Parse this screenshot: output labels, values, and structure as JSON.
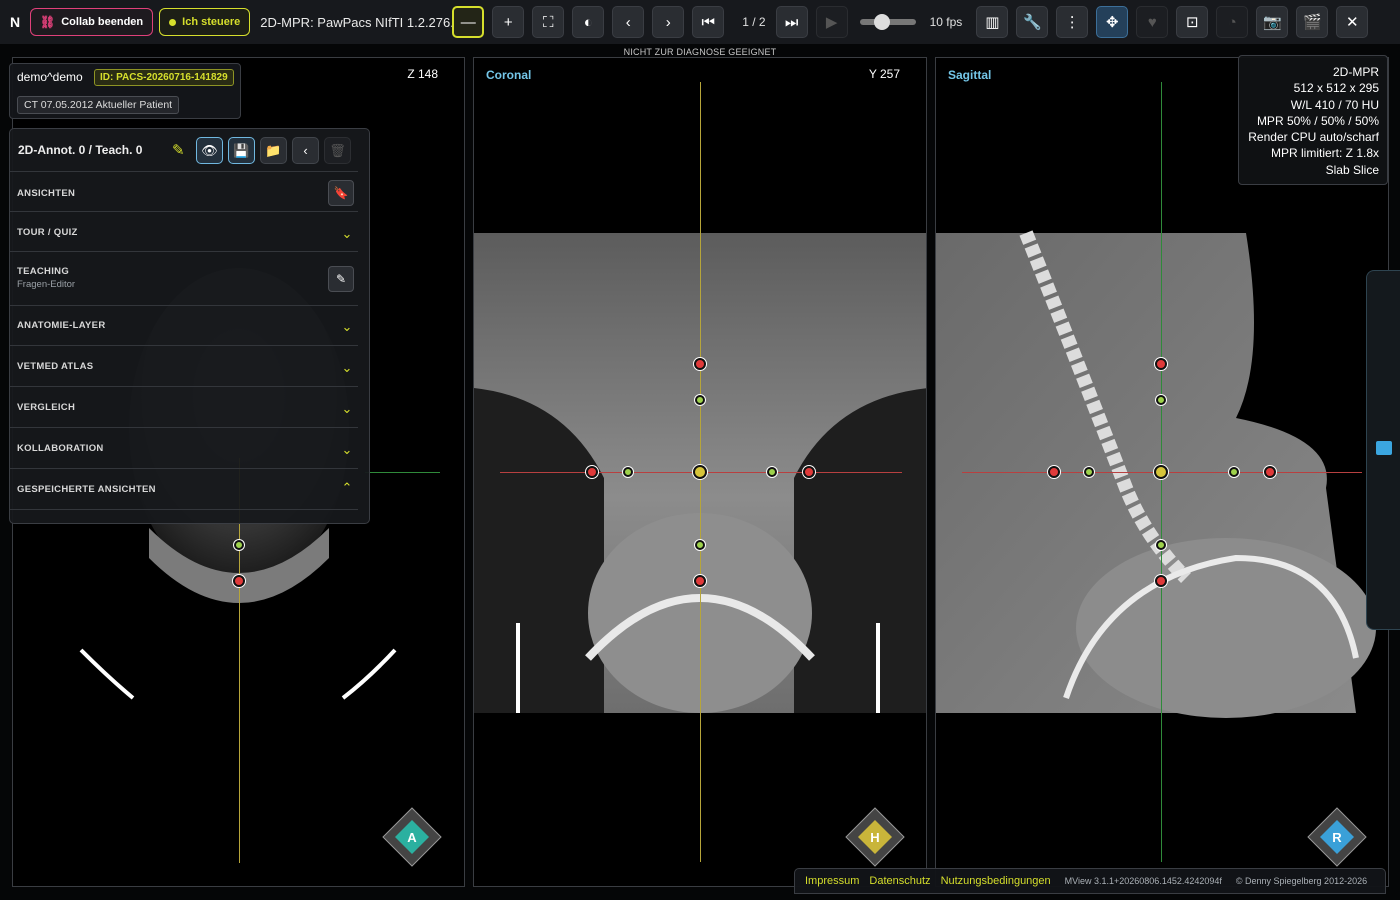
{
  "toolbar": {
    "logo": "N",
    "collab_label": "Collab beenden",
    "control_label": "Ich steuere",
    "title": "2D-MPR: PawPacs NIfTI 1.2.276...",
    "page_indicator": "1 / 2",
    "fps": "10 fps",
    "playback_speed_fraction": 0.35
  },
  "notice": "NICHT ZUR DIAGNOSE GEEIGNET",
  "patient": {
    "name": "demo^demo",
    "id_label": "ID: PACS-20260716-141829",
    "study": "CT 07.05.2012 Aktueller Patient"
  },
  "panel": {
    "header": "2D-Annot. 0 / Teach. 0",
    "sections": [
      {
        "label": "ANSICHTEN",
        "sub": ""
      },
      {
        "label": "TOUR / QUIZ",
        "sub": ""
      },
      {
        "label": "TEACHING",
        "sub": "Fragen-Editor"
      },
      {
        "label": "ANATOMIE-LAYER",
        "sub": ""
      },
      {
        "label": "VETMED ATLAS",
        "sub": ""
      },
      {
        "label": "VERGLEICH",
        "sub": ""
      },
      {
        "label": "KOLLABORATION",
        "sub": ""
      },
      {
        "label": "GESPEICHERTE ANSICHTEN",
        "sub": ""
      }
    ]
  },
  "viewports": {
    "axial": {
      "title": "",
      "coord": "Z 148",
      "cube_letter": "A",
      "cube_color": "#2bb0a0"
    },
    "coronal": {
      "title": "Coronal",
      "coord": "Y 257",
      "cube_letter": "H",
      "cube_color": "#c9b53a"
    },
    "sagittal": {
      "title": "Sagittal",
      "coord": "",
      "cube_letter": "R",
      "cube_color": "#3aa0d8"
    }
  },
  "info": {
    "lines": [
      "2D-MPR",
      "512 x 512 x 295",
      "W/L 410 / 70 HU",
      "MPR 50% / 50% / 50%",
      "Render CPU auto/scharf",
      "MPR limitiert: Z 1.8x",
      "Slab Slice"
    ]
  },
  "footer": {
    "impressum": "Impressum",
    "datenschutz": "Datenschutz",
    "nutzung": "Nutzungsbedingungen",
    "version": "MView 3.1.1+20260806.1452.4242094f",
    "copyright": "© Denny Spiegelberg 2012-2026"
  },
  "colors": {
    "accent_yellow": "#d6df2c",
    "accent_pink": "#e0407a",
    "accent_blue": "#74c6e8",
    "cross_vertical": "#b6a53a",
    "cross_horizontal": "#b84040",
    "cross_green": "#2f8a3a"
  }
}
